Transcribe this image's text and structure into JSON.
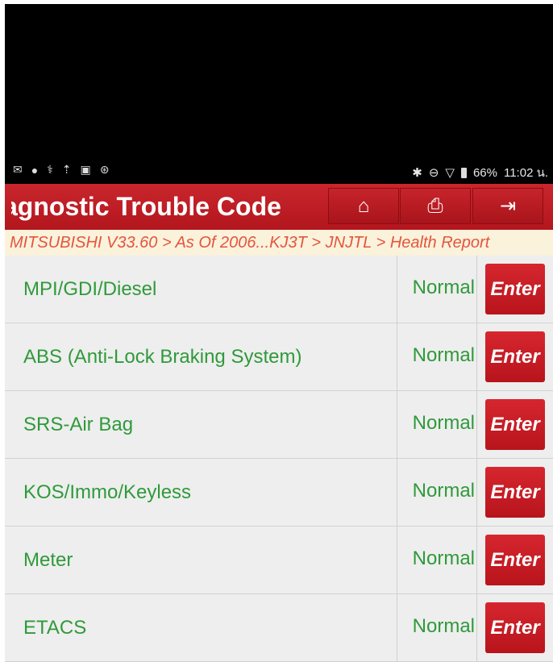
{
  "statusbar": {
    "left_icons": [
      "gmail-icon",
      "chat-icon",
      "stethoscope-icon",
      "upload-icon",
      "image-icon",
      "bluetooth-circle-icon"
    ],
    "battery": "66%",
    "time": "11:02 น."
  },
  "header": {
    "title": "Diagnostic Trouble Code",
    "buttons": [
      "home-icon",
      "print-icon",
      "exit-icon"
    ]
  },
  "breadcrumb": "MITSUBISHI V33.60 > As Of 2006...KJ3T > JNJTL > Health Report",
  "systems": [
    {
      "name": "MPI/GDI/Diesel",
      "status": "Normal",
      "action": "Enter"
    },
    {
      "name": "ABS (Anti-Lock Braking System)",
      "status": "Normal",
      "action": "Enter"
    },
    {
      "name": "SRS-Air Bag",
      "status": "Normal",
      "action": "Enter"
    },
    {
      "name": "KOS/Immo/Keyless",
      "status": "Normal",
      "action": "Enter"
    },
    {
      "name": "Meter",
      "status": "Normal",
      "action": "Enter"
    },
    {
      "name": "ETACS",
      "status": "Normal",
      "action": "Enter"
    }
  ],
  "colors": {
    "header_red": "#c3212a",
    "status_green": "#2f9a3a",
    "breadcrumb_text": "#e4553c",
    "breadcrumb_bg": "#fbf2dc"
  }
}
